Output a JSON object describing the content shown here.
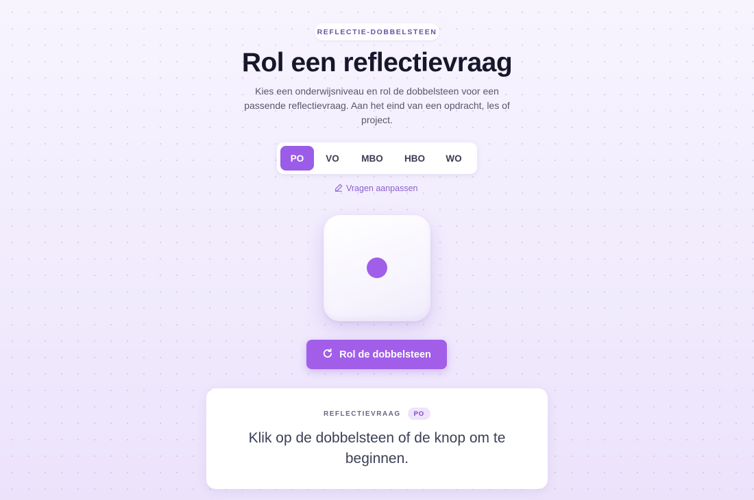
{
  "header": {
    "eyebrow": "REFLECTIE-DOBBELSTEEN",
    "title": "Rol een reflectievraag",
    "subtitle": "Kies een onderwijsniveau en rol de dobbelsteen voor een passende reflectievraag. Aan het eind van een opdracht, les of project."
  },
  "levels": {
    "selected": "PO",
    "items": [
      {
        "label": "PO",
        "active": true
      },
      {
        "label": "VO",
        "active": false
      },
      {
        "label": "MBO",
        "active": false
      },
      {
        "label": "HBO",
        "active": false
      },
      {
        "label": "WO",
        "active": false
      }
    ]
  },
  "edit_link": {
    "label": "Vragen aanpassen",
    "icon": "pencil-icon"
  },
  "die": {
    "face_value": 1,
    "pip_color": "#a05ee9"
  },
  "roll_button": {
    "label": "Rol de dobbelsteen",
    "icon": "refresh-icon"
  },
  "result_card": {
    "label": "REFLECTIEVRAAG",
    "badge": "PO",
    "question": "Klik op de dobbelsteen of de knop om te beginnen."
  },
  "colors": {
    "accent": "#9b5ce8",
    "title": "#17172b",
    "background": "#f3effd"
  }
}
